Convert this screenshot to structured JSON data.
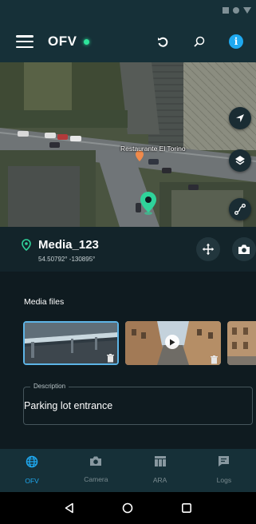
{
  "app": {
    "title": "OFV",
    "connection_status_color": "#2ee49b",
    "accent_color": "#1fa9f0"
  },
  "status_bar": {
    "icons": [
      "square-icon",
      "circle-icon",
      "triangle-icon"
    ]
  },
  "header": {
    "menu_icon": "hamburger-menu-icon",
    "actions": [
      "refresh-icon",
      "search-icon",
      "info-icon"
    ]
  },
  "map": {
    "poi_label": "Restaurante El Torino",
    "controls": [
      "navigation-arrow-icon",
      "layers-icon",
      "route-icon"
    ]
  },
  "media": {
    "title": "Media_123",
    "coordinates": "54.50792° -130895°",
    "actions": [
      "move-icon",
      "camera-icon"
    ]
  },
  "media_files": {
    "section_title": "Media files",
    "items": [
      {
        "type": "photo",
        "scene": "parking-garage",
        "selected": true
      },
      {
        "type": "video",
        "scene": "street",
        "selected": false
      },
      {
        "type": "photo",
        "scene": "street",
        "selected": false
      }
    ]
  },
  "description": {
    "label": "Description",
    "value": "Parking lot entrance"
  },
  "bottom_nav": {
    "items": [
      {
        "label": "OFV",
        "icon": "globe-icon",
        "active": true
      },
      {
        "label": "Camera",
        "icon": "camera-icon",
        "active": false
      },
      {
        "label": "ARA",
        "icon": "table-icon",
        "active": false
      },
      {
        "label": "Logs",
        "icon": "message-icon",
        "active": false
      }
    ]
  },
  "system_nav": [
    "back-icon",
    "home-icon",
    "recents-icon"
  ]
}
